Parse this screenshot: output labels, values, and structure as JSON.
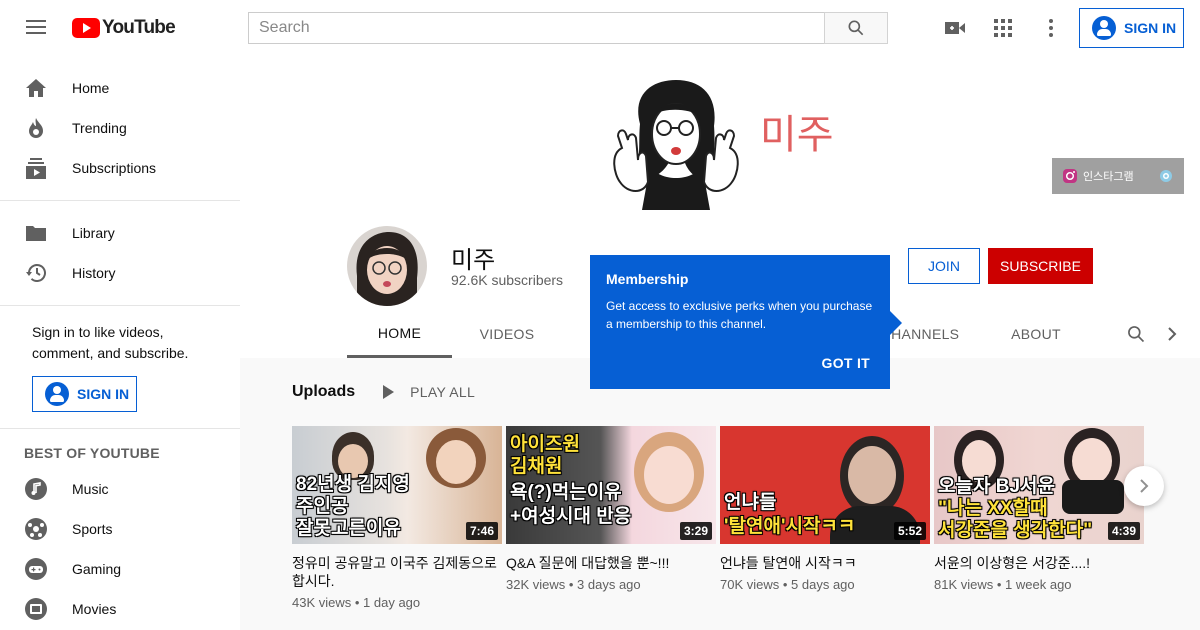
{
  "header": {
    "logo_text": "YouTube",
    "search_placeholder": "Search",
    "sign_in_label": "SIGN IN"
  },
  "sidebar": {
    "primary": [
      {
        "label": "Home",
        "icon": "home-icon"
      },
      {
        "label": "Trending",
        "icon": "flame-icon"
      },
      {
        "label": "Subscriptions",
        "icon": "subscriptions-icon"
      }
    ],
    "secondary": [
      {
        "label": "Library",
        "icon": "folder-icon"
      },
      {
        "label": "History",
        "icon": "history-icon"
      }
    ],
    "signin_prompt": "Sign in to like videos, comment, and subscribe.",
    "signin_label": "SIGN IN",
    "best_title": "BEST OF YOUTUBE",
    "best": [
      {
        "label": "Music",
        "icon": "music-icon"
      },
      {
        "label": "Sports",
        "icon": "sports-icon"
      },
      {
        "label": "Gaming",
        "icon": "gaming-icon"
      },
      {
        "label": "Movies",
        "icon": "movies-icon"
      }
    ]
  },
  "banner": {
    "art_text": "미주",
    "instagram_label": "인스타그램"
  },
  "channel": {
    "name": "미주",
    "subscribers": "92.6K subscribers",
    "join_label": "JOIN",
    "subscribe_label": "SUBSCRIBE",
    "tabs": [
      "HOME",
      "VIDEOS",
      "CHANNELS",
      "ABOUT"
    ]
  },
  "tooltip": {
    "title": "Membership",
    "body": "Get access to exclusive perks when you purchase a membership to this channel.",
    "button": "GOT IT"
  },
  "uploads": {
    "title": "Uploads",
    "play_all": "PLAY ALL",
    "videos": [
      {
        "title": "정유미 공유말고 이국주 김제동으로 합시다.",
        "views": "43K views",
        "age": "1 day ago",
        "duration": "7:46",
        "overlay": [
          "82년생 김지영",
          "주인공",
          "잘못고른이유"
        ]
      },
      {
        "title": "Q&A 질문에 대답했을 뿐~!!!",
        "views": "32K views",
        "age": "3 days ago",
        "duration": "3:29",
        "overlay": [
          "아이즈원",
          "김채원",
          "욕(?)먹는이유",
          "+여성시대 반응"
        ]
      },
      {
        "title": "언냐들 탈연애 시작ㅋㅋ",
        "views": "70K views",
        "age": "5 days ago",
        "duration": "5:52",
        "overlay": [
          "언냐들",
          "'탈연애'시작ㅋㅋ"
        ]
      },
      {
        "title": "서윤의 이상형은 서강준....!",
        "views": "81K views",
        "age": "1 week ago",
        "duration": "4:39",
        "overlay": [
          "오늘자 BJ서윤",
          "\"나는 XX할때",
          "서강준을 생각한다\""
        ]
      }
    ]
  },
  "colors": {
    "brand_red": "#ff0000",
    "subscribe_red": "#cc0000",
    "blue": "#065fd4"
  }
}
